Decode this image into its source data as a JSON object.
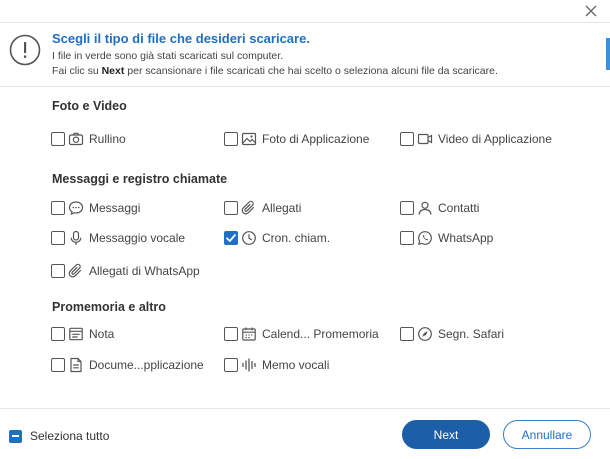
{
  "banner": {
    "title": "Scegli il tipo di file che desideri scaricare.",
    "line1": "I file in verde sono già stati scaricati sul computer.",
    "line2_prefix": "Fai clic su ",
    "line2_bold": "Next",
    "line2_suffix": " per scansionare i file scaricati che hai scelto o seleziona alcuni file da scaricare."
  },
  "sections": {
    "foto": {
      "title": "Foto e Video",
      "items": [
        {
          "label": "Rullino",
          "icon": "camera-icon",
          "checked": false
        },
        {
          "label": "Foto di Applicazione",
          "icon": "image-icon",
          "checked": false
        },
        {
          "label": "Video di Applicazione",
          "icon": "video-icon",
          "checked": false
        }
      ]
    },
    "messaggi": {
      "title": "Messaggi e registro chiamate",
      "items": [
        {
          "label": "Messaggi",
          "icon": "message-icon",
          "checked": false
        },
        {
          "label": "Allegati",
          "icon": "paperclip-icon",
          "checked": false
        },
        {
          "label": "Contatti",
          "icon": "contact-icon",
          "checked": false
        },
        {
          "label": "Messaggio vocale",
          "icon": "microphone-icon",
          "checked": false
        },
        {
          "label": "Cron. chiam.",
          "icon": "clock-icon",
          "checked": true
        },
        {
          "label": "WhatsApp",
          "icon": "whatsapp-icon",
          "checked": false
        },
        {
          "label": "Allegati di WhatsApp",
          "icon": "paperclip-icon",
          "checked": false
        }
      ]
    },
    "promemoria": {
      "title": "Promemoria e altro",
      "items": [
        {
          "label": "Nota",
          "icon": "note-icon",
          "checked": false
        },
        {
          "label": "Calend... Promemoria",
          "icon": "calendar-icon",
          "checked": false
        },
        {
          "label": "Segn. Safari",
          "icon": "compass-icon",
          "checked": false
        },
        {
          "label": "Docume...pplicazione",
          "icon": "document-icon",
          "checked": false
        },
        {
          "label": "Memo vocali",
          "icon": "waveform-icon",
          "checked": false
        }
      ]
    }
  },
  "footer": {
    "select_all": "Seleziona tutto",
    "next": "Next",
    "cancel": "Annullare"
  },
  "colors": {
    "accent": "#1f6fc4",
    "primary_button": "#1d5ea8"
  }
}
